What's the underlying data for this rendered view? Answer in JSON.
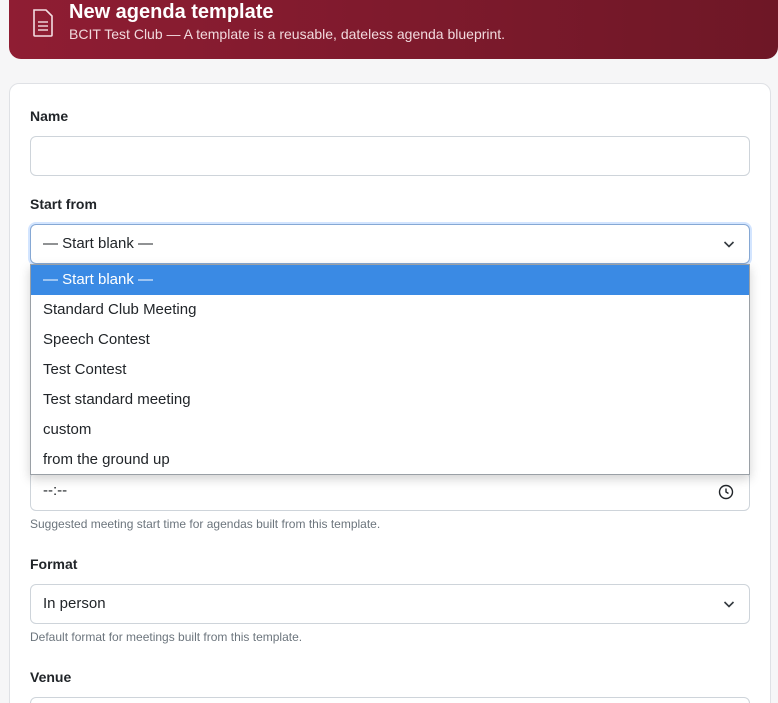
{
  "header": {
    "title": "New agenda template",
    "subtitle": "BCIT Test Club — A template is a reusable, dateless agenda blueprint.",
    "icon": "document-icon",
    "colors": {
      "start": "#8f1d33",
      "end": "#6e1726"
    }
  },
  "form": {
    "name_label": "Name",
    "name_value": "",
    "start_from_label": "Start from",
    "start_from_value": "— Start blank —",
    "start_from_options": [
      "— Start blank —",
      "Standard Club Meeting",
      "Speech Contest",
      "Test Contest",
      "Test standard meeting",
      "custom",
      "from the ground up"
    ],
    "selected_option_index": 0,
    "time_value": "--:--",
    "time_help": "Suggested meeting start time for agendas built from this template.",
    "format_label": "Format",
    "format_value": "In person",
    "format_help": "Default format for meetings built from this template.",
    "venue_label": "Venue"
  },
  "colors": {
    "selection": "#3a8ae4",
    "accent": "#8f1d33"
  }
}
